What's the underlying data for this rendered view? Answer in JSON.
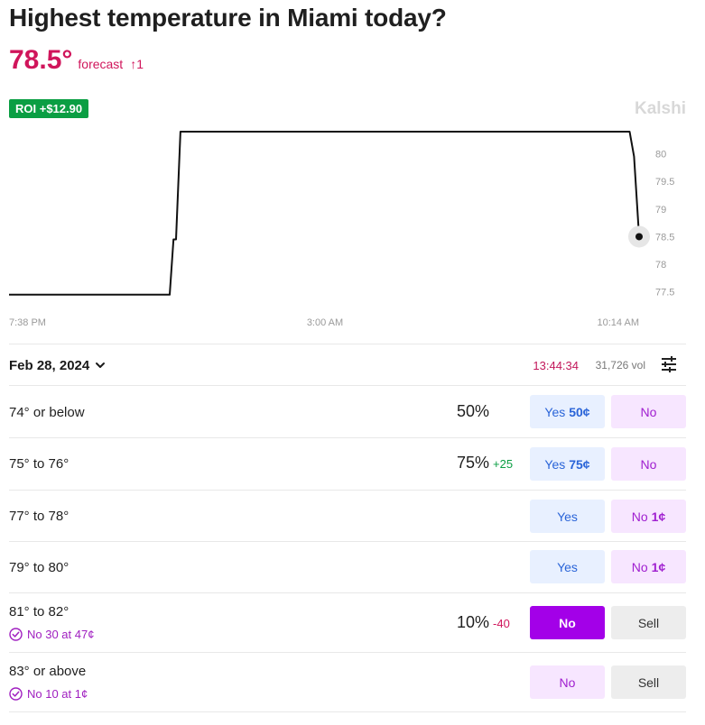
{
  "header": {
    "title": "Highest temperature in Miami today?",
    "current_temp": "78.5°",
    "forecast_label": "forecast",
    "forecast_change": "↑1",
    "roi_badge": "ROI +$12.90",
    "brand": "Kalshi"
  },
  "chart_data": {
    "type": "line",
    "line_shape": "step",
    "x_ticks": [
      "7:38 PM",
      "3:00 AM",
      "10:14 AM"
    ],
    "y_ticks": [
      80,
      79.5,
      79,
      78.5,
      78,
      77.5
    ],
    "y_axis_side": "right",
    "ylim": [
      77.3,
      80.4
    ],
    "grid": false,
    "series": [
      {
        "color": "#111111",
        "values": [
          {
            "t": 0.0,
            "y": 77.45
          },
          {
            "t": 0.255,
            "y": 77.45
          },
          {
            "t": 0.261,
            "y": 78.45
          },
          {
            "t": 0.265,
            "y": 78.45
          },
          {
            "t": 0.272,
            "y": 80.4
          },
          {
            "t": 0.985,
            "y": 80.4
          },
          {
            "t": 0.992,
            "y": 79.95
          },
          {
            "t": 1.0,
            "y": 78.5
          }
        ]
      }
    ],
    "last_point_marker": true
  },
  "market": {
    "date": "Feb 28, 2024",
    "timer": "13:44:34",
    "volume": "31,726 vol",
    "rows": [
      {
        "label": "74° or below",
        "pct": "50%",
        "delta": "",
        "yes": "Yes",
        "yes_price": "50¢",
        "no": "No",
        "no_price": ""
      },
      {
        "label": "75° to 76°",
        "pct": "75%",
        "delta": "+25",
        "yes": "Yes",
        "yes_price": "75¢",
        "no": "No",
        "no_price": ""
      },
      {
        "label": "77° to 78°",
        "pct": "",
        "delta": "",
        "yes": "Yes",
        "yes_price": "",
        "no": "No",
        "no_price": "1¢"
      },
      {
        "label": "79° to 80°",
        "pct": "",
        "delta": "",
        "yes": "Yes",
        "yes_price": "",
        "no": "No",
        "no_price": "1¢"
      },
      {
        "label": "81° to 82°",
        "position": "No 30 at 47¢",
        "pct": "10%",
        "delta": "-40",
        "no": "No",
        "sell": "Sell"
      },
      {
        "label": "83° or above",
        "position": "No 10 at 1¢",
        "pct": "",
        "delta": "",
        "no": "No",
        "sell": "Sell"
      }
    ]
  }
}
